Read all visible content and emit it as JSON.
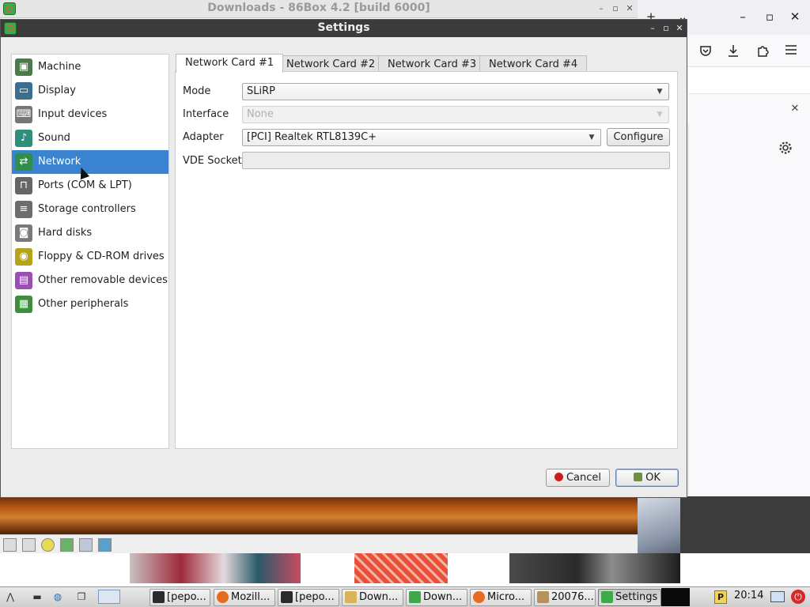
{
  "background_window": {
    "title": "Downloads - 86Box 4.2 [build 6000]",
    "controls": [
      "–",
      "▫",
      "✕"
    ]
  },
  "firefox": {
    "tab_controls": [
      "+",
      "⌄"
    ],
    "window_controls": [
      "–",
      "▫",
      "✕"
    ],
    "toolbar_icons": [
      "pocket-icon",
      "download-icon",
      "extensions-icon",
      "menu-icon"
    ],
    "notification_close": "✕",
    "settings_icon": "gear-icon"
  },
  "settings": {
    "title": "Settings",
    "window_controls": [
      "–",
      "▫",
      "✕"
    ],
    "categories": [
      {
        "label": "Machine",
        "icon": "machine-icon",
        "color": "#4c7a4c"
      },
      {
        "label": "Display",
        "icon": "display-icon",
        "color": "#3c6e8f"
      },
      {
        "label": "Input devices",
        "icon": "input-devices-icon",
        "color": "#777777"
      },
      {
        "label": "Sound",
        "icon": "sound-icon",
        "color": "#2f8f7a"
      },
      {
        "label": "Network",
        "icon": "network-icon",
        "color": "#2f8f4a"
      },
      {
        "label": "Ports (COM & LPT)",
        "icon": "ports-icon",
        "color": "#666666"
      },
      {
        "label": "Storage controllers",
        "icon": "storage-controllers-icon",
        "color": "#6d6d6d"
      },
      {
        "label": "Hard disks",
        "icon": "hard-disk-icon",
        "color": "#7a7a7a"
      },
      {
        "label": "Floppy & CD-ROM drives",
        "icon": "floppy-cdrom-icon",
        "color": "#b5a31a"
      },
      {
        "label": "Other removable devices",
        "icon": "removable-devices-icon",
        "color": "#9a4fb5"
      },
      {
        "label": "Other peripherals",
        "icon": "peripherals-icon",
        "color": "#3d8f3d"
      }
    ],
    "selected_category": "Network",
    "tabs": [
      "Network Card #1",
      "Network Card #2",
      "Network Card #3",
      "Network Card #4"
    ],
    "active_tab": "Network Card #1",
    "form": {
      "mode_label": "Mode",
      "mode_value": "SLiRP",
      "interface_label": "Interface",
      "interface_value": "None",
      "adapter_label": "Adapter",
      "adapter_value": "[PCI] Realtek RTL8139C+",
      "configure_label": "Configure",
      "vde_label": "VDE Socket",
      "vde_value": ""
    },
    "buttons": {
      "cancel": "Cancel",
      "ok": "OK"
    }
  },
  "taskbar": {
    "launchers": [
      "start-menu-icon",
      "files-icon",
      "browser-icon",
      "windows-icon",
      "desktop-icon"
    ],
    "items": [
      {
        "label": "[pepo...",
        "icon": "terminal-icon",
        "color": "#2b2b2b"
      },
      {
        "label": "Mozill...",
        "icon": "firefox-icon",
        "color": "#e66a1f"
      },
      {
        "label": "[pepo...",
        "icon": "terminal-icon",
        "color": "#2b2b2b"
      },
      {
        "label": "Down...",
        "icon": "folder-icon",
        "color": "#d9b25a"
      },
      {
        "label": "Down...",
        "icon": "86box-icon",
        "color": "#3ea84a"
      },
      {
        "label": "Micro...",
        "icon": "firefox-icon",
        "color": "#e66a1f"
      },
      {
        "label": "20076...",
        "icon": "image-viewer-icon",
        "color": "#b8905a"
      },
      {
        "label": "Settings",
        "icon": "86box-icon",
        "color": "#3ea84a"
      }
    ],
    "active_item": "Settings",
    "clock": "20:14"
  }
}
